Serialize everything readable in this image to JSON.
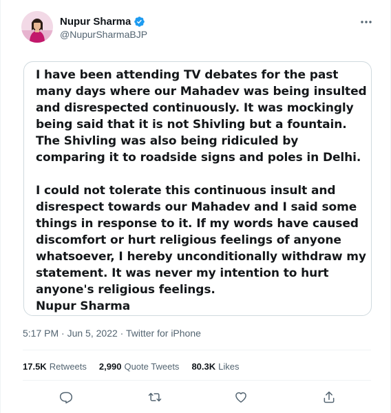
{
  "author": {
    "name": "Nupur Sharma",
    "handle": "@NupurSharmaBJP",
    "verified": true
  },
  "statement": {
    "paragraph1": "I have been attending TV debates for the past many days where our Mahadev was being insulted and disrespected continuously. It was mockingly being said that it is not Shivling but a fountain. The Shivling was also being ridiculed by comparing it to roadside signs and poles in Delhi.",
    "paragraph2": "I could not tolerate this continuous insult and disrespect towards our Mahadev and I said some things in response to it. If my words have caused discomfort or hurt religious feelings of anyone whatsoever, I hereby unconditionally withdraw my statement. It was never my intention to hurt anyone's religious feelings.",
    "signature": "Nupur Sharma"
  },
  "meta": {
    "time": "5:17 PM",
    "separator": "·",
    "date": "Jun 5, 2022",
    "source": "Twitter for iPhone"
  },
  "stats": {
    "retweets_count": "17.5K",
    "retweets_label": "Retweets",
    "quotes_count": "2,990",
    "quotes_label": "Quote Tweets",
    "likes_count": "80.3K",
    "likes_label": "Likes"
  },
  "icons": {
    "more": "more-dots-icon",
    "reply": "reply-icon",
    "retweet": "retweet-icon",
    "like": "heart-icon",
    "share": "share-icon",
    "verified": "verified-badge-icon"
  },
  "colors": {
    "verified": "#1d9bf0",
    "secondary_text": "#536471",
    "border": "#cfd9de",
    "divider": "#eff3f4"
  }
}
